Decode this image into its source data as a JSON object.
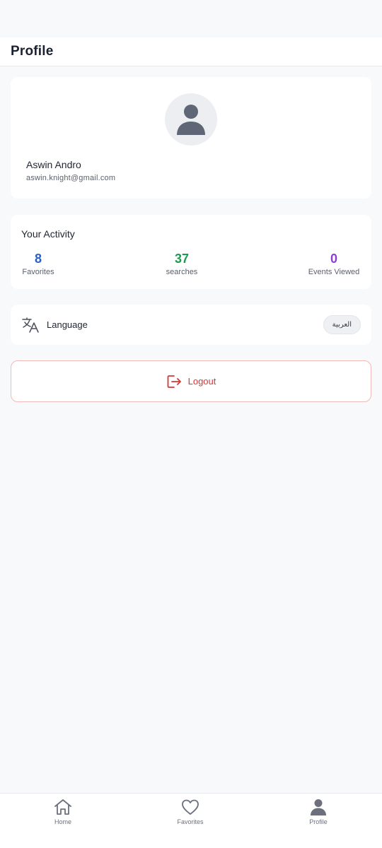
{
  "header": {
    "title": "Profile"
  },
  "profile": {
    "avatar_icon": "user-avatar-icon",
    "name": "Aswin Andro",
    "email": "aswin.knight@gmail.com"
  },
  "activity": {
    "title": "Your Activity",
    "stats": [
      {
        "value": "8",
        "label": "Favorites",
        "color": "#2a5fc4"
      },
      {
        "value": "37",
        "label": "searches",
        "color": "#1f9a52"
      },
      {
        "value": "0",
        "label": "Events Viewed",
        "color": "#8a3fd1"
      }
    ]
  },
  "language": {
    "icon": "translate-icon",
    "label": "Language",
    "badge": "العربية"
  },
  "logout": {
    "icon": "logout-icon",
    "label": "Logout",
    "color": "#d93636"
  },
  "bottom_nav": {
    "items": [
      {
        "label": "Home",
        "icon": "home-icon"
      },
      {
        "label": "Favorites",
        "icon": "heart-icon"
      },
      {
        "label": "Profile",
        "icon": "profile-icon"
      }
    ]
  }
}
